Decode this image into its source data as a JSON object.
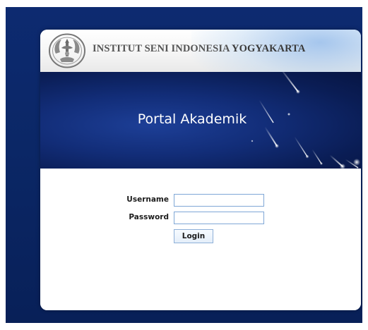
{
  "header": {
    "institution_part1": "INSTITUT SENI INDONESIA ",
    "institution_part2": "YOGYAKARTA",
    "logo_icon": "isi-emblem-icon"
  },
  "banner": {
    "title": "Portal Akademik"
  },
  "login_form": {
    "username_label": "Username",
    "username_value": "",
    "password_label": "Password",
    "password_value": "",
    "login_button_label": "Login"
  },
  "colors": {
    "page_background": "#0b2766",
    "banner_dark": "#0a1d55",
    "input_border": "#7fa7d6",
    "header_text": "#555555"
  }
}
